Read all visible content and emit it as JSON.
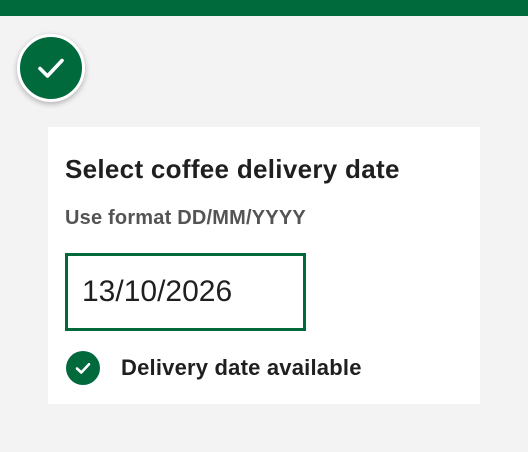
{
  "colors": {
    "brand": "#006a3d",
    "background": "#f3f3f3",
    "card": "#ffffff",
    "text": "#1f1f1f",
    "hint": "#545454"
  },
  "header": {
    "badge_icon": "check-icon"
  },
  "form": {
    "title": "Select coffee delivery date",
    "hint": "Use format DD/MM/YYYY",
    "date_value": "13/10/2026",
    "status_icon": "check-circle-icon",
    "status_text": "Delivery date available"
  }
}
